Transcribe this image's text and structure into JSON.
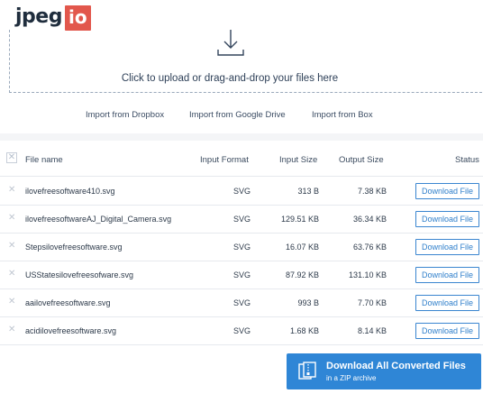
{
  "logo": {
    "text": "jpeg",
    "badge": "io"
  },
  "upload": {
    "prompt": "Click to upload or drag-and-drop your files here",
    "icon": "download-arrow-icon"
  },
  "imports": [
    "Import from Dropbox",
    "Import from Google Drive",
    "Import from Box"
  ],
  "table": {
    "headers": {
      "filename": "File name",
      "format": "Input Format",
      "input_size": "Input Size",
      "output_size": "Output Size",
      "status": "Status"
    },
    "rows": [
      {
        "name": "ilovefreesoftware410.svg",
        "format": "SVG",
        "input_size": "313 B",
        "output_size": "7.38 KB",
        "action": "Download File"
      },
      {
        "name": "ilovefreesoftwareAJ_Digital_Camera.svg",
        "format": "SVG",
        "input_size": "129.51 KB",
        "output_size": "36.34 KB",
        "action": "Download File"
      },
      {
        "name": "Stepsilovefreesoftware.svg",
        "format": "SVG",
        "input_size": "16.07 KB",
        "output_size": "63.76 KB",
        "action": "Download File"
      },
      {
        "name": "USStatesilovefreesofware.svg",
        "format": "SVG",
        "input_size": "87.92 KB",
        "output_size": "131.10 KB",
        "action": "Download File"
      },
      {
        "name": "aailovefreesoftware.svg",
        "format": "SVG",
        "input_size": "993 B",
        "output_size": "7.70 KB",
        "action": "Download File"
      },
      {
        "name": "acidilovefreesoftware.svg",
        "format": "SVG",
        "input_size": "1.68 KB",
        "output_size": "8.14 KB",
        "action": "Download File"
      }
    ]
  },
  "zip": {
    "title": "Download All Converted Files",
    "subtitle": "in a ZIP archive",
    "icon": "zip-archive-icon"
  },
  "colors": {
    "brand": "#e2574c",
    "accent": "#2f86d6",
    "background": "#f4f5f7"
  }
}
